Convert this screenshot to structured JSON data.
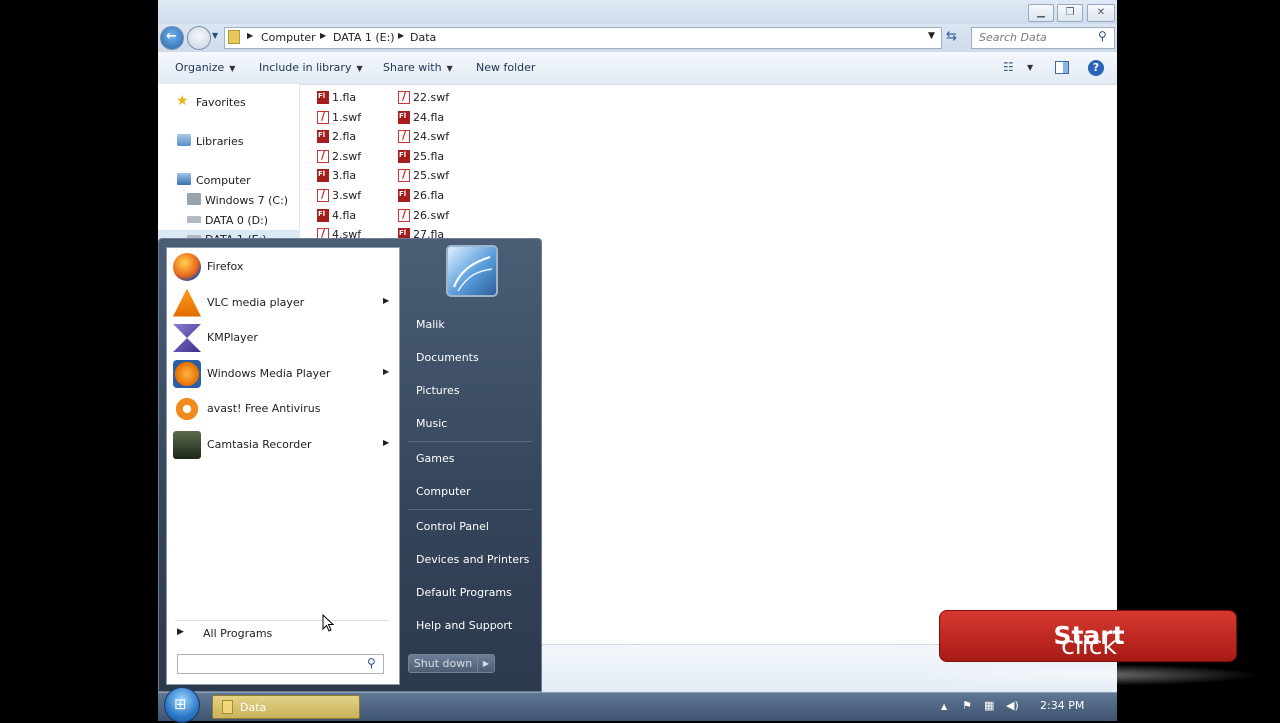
{
  "explorer": {
    "breadcrumb": [
      "Computer",
      "DATA 1 (E:)",
      "Data"
    ],
    "search_placeholder": "Search Data",
    "toolbar": {
      "organize": "Organize",
      "include_in_library": "Include in library",
      "share_with": "Share with",
      "new_folder": "New folder"
    },
    "nav": {
      "favorites": "Favorites",
      "libraries": "Libraries",
      "computer": "Computer",
      "drives": [
        "Windows 7 (C:)",
        "DATA 0 (D:)",
        "DATA 1 (E:)"
      ]
    },
    "files_col1": [
      {
        "name": "1.fla",
        "type": "fla"
      },
      {
        "name": "1.swf",
        "type": "swf"
      },
      {
        "name": "2.fla",
        "type": "fla"
      },
      {
        "name": "2.swf",
        "type": "swf"
      },
      {
        "name": "3.fla",
        "type": "fla"
      },
      {
        "name": "3.swf",
        "type": "swf"
      },
      {
        "name": "4.fla",
        "type": "fla"
      },
      {
        "name": "4.swf",
        "type": "swf"
      }
    ],
    "files_col2": [
      {
        "name": "22.swf",
        "type": "swf"
      },
      {
        "name": "24.fla",
        "type": "fla"
      },
      {
        "name": "24.swf",
        "type": "swf"
      },
      {
        "name": "25.fla",
        "type": "fla"
      },
      {
        "name": "25.swf",
        "type": "swf"
      },
      {
        "name": "26.fla",
        "type": "fla"
      },
      {
        "name": "26.swf",
        "type": "swf"
      },
      {
        "name": "27.fla",
        "type": "fla"
      }
    ]
  },
  "start_menu": {
    "pinned": [
      {
        "label": "Firefox",
        "icon": "firefox-icon",
        "has_submenu": false
      },
      {
        "label": "VLC media player",
        "icon": "vlc-icon",
        "has_submenu": true
      },
      {
        "label": "KMPlayer",
        "icon": "kmplayer-icon",
        "has_submenu": false
      },
      {
        "label": "Windows Media Player",
        "icon": "windows-media-player-icon",
        "has_submenu": true
      },
      {
        "label": "avast! Free Antivirus",
        "icon": "avast-icon",
        "has_submenu": false
      },
      {
        "label": "Camtasia Recorder",
        "icon": "camtasia-recorder-icon",
        "has_submenu": true
      }
    ],
    "all_programs": "All Programs",
    "right_items": {
      "user": "Malik",
      "documents": "Documents",
      "pictures": "Pictures",
      "music": "Music",
      "games": "Games",
      "computer": "Computer",
      "control_panel": "Control Panel",
      "devices_printers": "Devices and Printers",
      "default_programs": "Default Programs",
      "help_support": "Help and Support"
    },
    "shutdown": "Shut down"
  },
  "taskbar": {
    "window_button": "Data",
    "clock": "2:34 PM"
  },
  "caption": {
    "prefix": "click",
    "emphasis": "Start"
  },
  "colors": {
    "caption_red": "#c42a23",
    "start_menu_dark": "#34445a",
    "taskbar": "#4b6280"
  }
}
